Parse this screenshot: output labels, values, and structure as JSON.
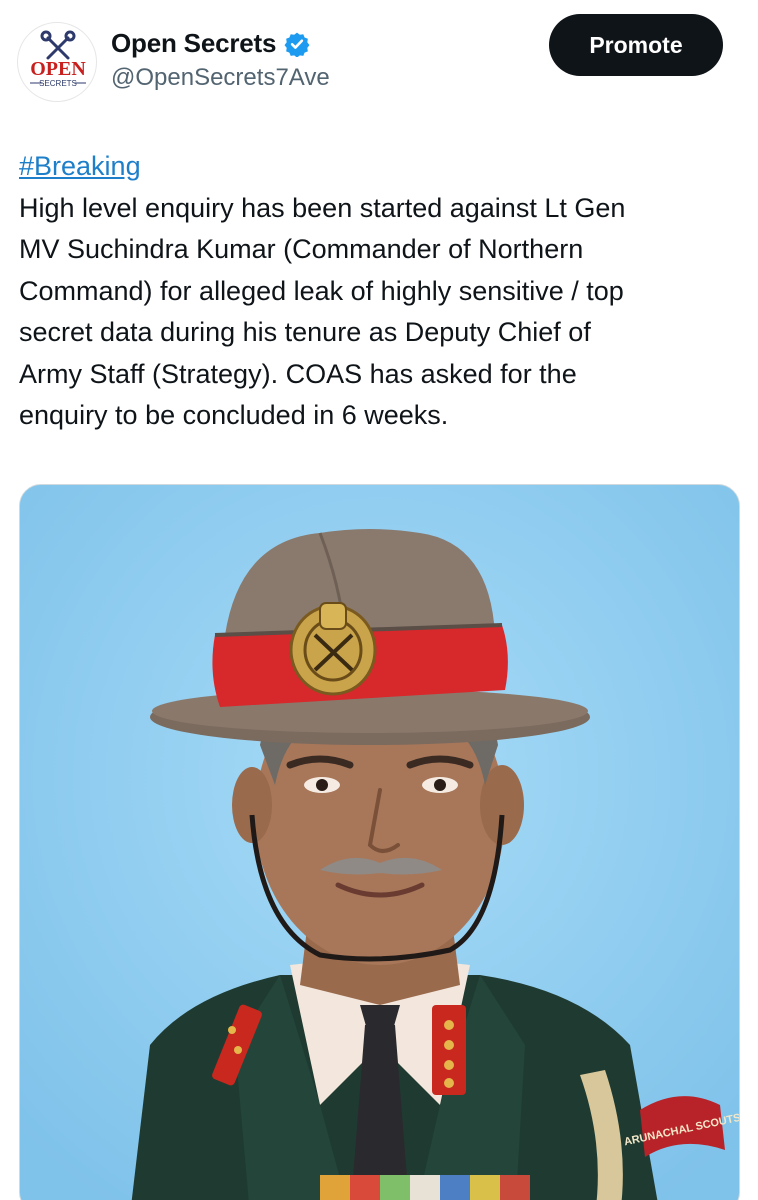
{
  "account": {
    "display_name": "Open Secrets",
    "handle": "@OpenSecrets7Ave",
    "verified_icon": "verified-badge-icon",
    "avatar_logo_text": "OPEN",
    "avatar_logo_subtext": "SECRETS"
  },
  "actions": {
    "promote_label": "Promote"
  },
  "tweet": {
    "hashtag": "#Breaking",
    "lines": [
      "High level enquiry has been started against Lt Gen",
      "MV Suchindra Kumar (Commander of Northern",
      "Command) for alleged leak of highly sensitive / top",
      "secret data during his tenure as Deputy Chief of",
      "Army Staff (Strategy). COAS has asked for the",
      "enquiry to be concluded in 6 weeks."
    ]
  },
  "media": {
    "badge_text": "ARUNACHAL SCOUTS"
  },
  "colors": {
    "hashtag": "#1d7fc9",
    "button_bg": "#0f1419",
    "verified": "#1d9bf0",
    "photo_background": "#8fcdf0",
    "logo_red": "#c8201e",
    "logo_navy": "#2d3a6b"
  }
}
